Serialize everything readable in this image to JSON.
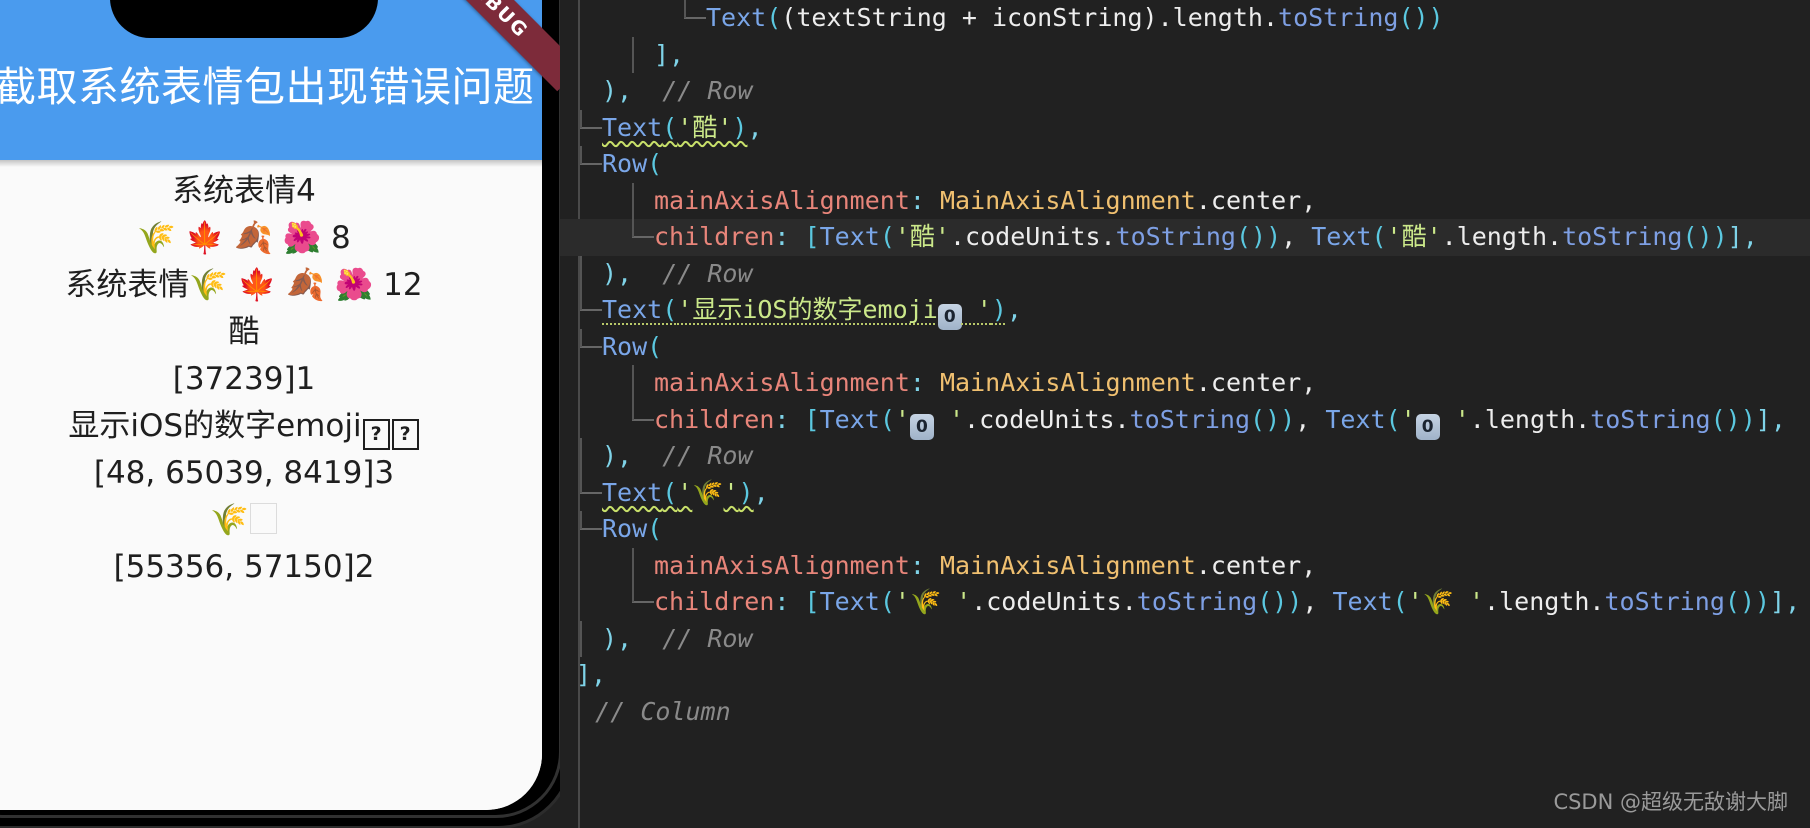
{
  "phone": {
    "appbar": {
      "title": "串截取系统表情包出现错误问题",
      "background": "#4a9bee"
    },
    "status_bar": {
      "signal_icon": "signal-dots-icon",
      "wifi_icon": "wifi-icon",
      "battery_icon": "battery-icon"
    },
    "debug_banner": "DEBUG",
    "body_lines": [
      {
        "id": "line-1",
        "text": "系统表情4"
      },
      {
        "id": "line-2",
        "text": "🌾 🍁 🍂 🌺 8"
      },
      {
        "id": "line-3",
        "text": "系统表情🌾 🍁 🍂 🌺 12"
      },
      {
        "id": "line-4",
        "text": "酷"
      },
      {
        "id": "line-5",
        "text": "[37239]1"
      },
      {
        "id": "line-6",
        "text": "显示iOS的数字emoji"
      },
      {
        "id": "line-7",
        "text": "[48, 65039, 8419]3"
      },
      {
        "id": "line-8",
        "text": "🌾"
      },
      {
        "id": "line-9",
        "text": "[55356, 57150]2"
      }
    ]
  },
  "editor": {
    "background": "#212121",
    "lines": [
      {
        "indent": 4,
        "guide": "branch",
        "parts": [
          {
            "t": "Text",
            "c": "kw"
          },
          {
            "t": "(",
            "c": "par"
          },
          {
            "t": "(textString + iconString)",
            "c": "plain"
          },
          {
            "t": ".",
            "c": "plain"
          },
          {
            "t": "length",
            "c": "plain"
          },
          {
            "t": ".",
            "c": "plain"
          },
          {
            "t": "toString",
            "c": "id-blue"
          },
          {
            "t": "())",
            "c": "par"
          }
        ]
      },
      {
        "indent": 2,
        "guide": "vline",
        "parts": [
          {
            "t": "],",
            "c": "punct"
          }
        ]
      },
      {
        "indent": 0,
        "guide": "none",
        "parts": [
          {
            "t": "),",
            "c": "punct"
          },
          {
            "t": "  // Row",
            "c": "cmt"
          }
        ]
      },
      {
        "indent": 0,
        "guide": "branch",
        "parts": [
          {
            "t": "Text",
            "c": "kw squig"
          },
          {
            "t": "(",
            "c": "par squig"
          },
          {
            "t": "'酷'",
            "c": "str squig"
          },
          {
            "t": ")",
            "c": "par squig"
          },
          {
            "t": ",",
            "c": "punct"
          }
        ]
      },
      {
        "indent": 0,
        "guide": "branch",
        "parts": [
          {
            "t": "Row",
            "c": "kw"
          },
          {
            "t": "(",
            "c": "par"
          }
        ]
      },
      {
        "indent": 2,
        "guide": "vline",
        "parts": [
          {
            "t": "mainAxisAlignment",
            "c": "param"
          },
          {
            "t": ": ",
            "c": "punct"
          },
          {
            "t": "MainAxisAlignment",
            "c": "enumv"
          },
          {
            "t": ".center",
            "c": "plain"
          },
          {
            "t": ",",
            "c": "plain"
          }
        ]
      },
      {
        "indent": 2,
        "guide": "branch",
        "hl": true,
        "parts": [
          {
            "t": "children",
            "c": "param"
          },
          {
            "t": ": ",
            "c": "punct"
          },
          {
            "t": "[",
            "c": "par"
          },
          {
            "t": "Text",
            "c": "kw"
          },
          {
            "t": "(",
            "c": "par"
          },
          {
            "t": "'酷'",
            "c": "str"
          },
          {
            "t": ".codeUnits.",
            "c": "plain"
          },
          {
            "t": "toString",
            "c": "id-blue"
          },
          {
            "t": "())",
            "c": "par"
          },
          {
            "t": ", ",
            "c": "plain"
          },
          {
            "t": "Text",
            "c": "kw"
          },
          {
            "t": "(",
            "c": "par"
          },
          {
            "t": "'酷'",
            "c": "str"
          },
          {
            "t": ".length.",
            "c": "plain"
          },
          {
            "t": "toString",
            "c": "id-blue"
          },
          {
            "t": "())",
            "c": "par"
          },
          {
            "t": "],",
            "c": "punct"
          }
        ]
      },
      {
        "indent": 0,
        "guide": "vline",
        "parts": [
          {
            "t": "),",
            "c": "punct"
          },
          {
            "t": "  // Row",
            "c": "cmt"
          }
        ]
      },
      {
        "indent": 0,
        "guide": "branch",
        "parts": [
          {
            "t": "Text",
            "c": "kw squig-dot"
          },
          {
            "t": "(",
            "c": "par squig-dot"
          },
          {
            "t": "'显示iOS的数字emoji",
            "c": "str squig-dot"
          },
          {
            "t": "0",
            "c": "keycap"
          },
          {
            "t": " '",
            "c": "str squig-dot"
          },
          {
            "t": ")",
            "c": "par squig-dot"
          },
          {
            "t": ",",
            "c": "punct"
          }
        ]
      },
      {
        "indent": 0,
        "guide": "branch",
        "parts": [
          {
            "t": "Row",
            "c": "kw"
          },
          {
            "t": "(",
            "c": "par"
          }
        ]
      },
      {
        "indent": 2,
        "guide": "vline",
        "parts": [
          {
            "t": "mainAxisAlignment",
            "c": "param"
          },
          {
            "t": ": ",
            "c": "punct"
          },
          {
            "t": "MainAxisAlignment",
            "c": "enumv"
          },
          {
            "t": ".center",
            "c": "plain"
          },
          {
            "t": ",",
            "c": "plain"
          }
        ]
      },
      {
        "indent": 2,
        "guide": "branch",
        "parts": [
          {
            "t": "children",
            "c": "param"
          },
          {
            "t": ": ",
            "c": "punct"
          },
          {
            "t": "[",
            "c": "par"
          },
          {
            "t": "Text",
            "c": "kw"
          },
          {
            "t": "(",
            "c": "par"
          },
          {
            "t": "'",
            "c": "str"
          },
          {
            "t": "0",
            "c": "keycap"
          },
          {
            "t": " '",
            "c": "str"
          },
          {
            "t": ".codeUnits.",
            "c": "plain"
          },
          {
            "t": "toString",
            "c": "id-blue"
          },
          {
            "t": "())",
            "c": "par"
          },
          {
            "t": ", ",
            "c": "plain"
          },
          {
            "t": "Text",
            "c": "kw"
          },
          {
            "t": "(",
            "c": "par"
          },
          {
            "t": "'",
            "c": "str"
          },
          {
            "t": "0",
            "c": "keycap"
          },
          {
            "t": " '",
            "c": "str"
          },
          {
            "t": ".length.",
            "c": "plain"
          },
          {
            "t": "toString",
            "c": "id-blue"
          },
          {
            "t": "())",
            "c": "par"
          },
          {
            "t": "],",
            "c": "punct"
          }
        ]
      },
      {
        "indent": 0,
        "guide": "vline",
        "parts": [
          {
            "t": "),",
            "c": "punct"
          },
          {
            "t": "  // Row",
            "c": "cmt"
          }
        ]
      },
      {
        "indent": 0,
        "guide": "branch",
        "parts": [
          {
            "t": "Text",
            "c": "kw squig"
          },
          {
            "t": "(",
            "c": "par squig"
          },
          {
            "t": "'",
            "c": "str squig"
          },
          {
            "t": "🌾",
            "c": "emo"
          },
          {
            "t": "'",
            "c": "str squig"
          },
          {
            "t": ")",
            "c": "par squig"
          },
          {
            "t": ",",
            "c": "punct"
          }
        ]
      },
      {
        "indent": 0,
        "guide": "branch",
        "parts": [
          {
            "t": "Row",
            "c": "kw"
          },
          {
            "t": "(",
            "c": "par"
          }
        ]
      },
      {
        "indent": 2,
        "guide": "vline",
        "parts": [
          {
            "t": "mainAxisAlignment",
            "c": "param"
          },
          {
            "t": ": ",
            "c": "punct"
          },
          {
            "t": "MainAxisAlignment",
            "c": "enumv"
          },
          {
            "t": ".center",
            "c": "plain"
          },
          {
            "t": ",",
            "c": "plain"
          }
        ]
      },
      {
        "indent": 2,
        "guide": "branch",
        "parts": [
          {
            "t": "children",
            "c": "param"
          },
          {
            "t": ": ",
            "c": "punct"
          },
          {
            "t": "[",
            "c": "par"
          },
          {
            "t": "Text",
            "c": "kw"
          },
          {
            "t": "(",
            "c": "par"
          },
          {
            "t": "'",
            "c": "str"
          },
          {
            "t": "🌾",
            "c": "emo"
          },
          {
            "t": " '",
            "c": "str"
          },
          {
            "t": ".codeUnits.",
            "c": "plain"
          },
          {
            "t": "toString",
            "c": "id-blue"
          },
          {
            "t": "())",
            "c": "par"
          },
          {
            "t": ", ",
            "c": "plain"
          },
          {
            "t": "Text",
            "c": "kw"
          },
          {
            "t": "(",
            "c": "par"
          },
          {
            "t": "'",
            "c": "str"
          },
          {
            "t": "🌾",
            "c": "emo"
          },
          {
            "t": " '",
            "c": "str"
          },
          {
            "t": ".length.",
            "c": "plain"
          },
          {
            "t": "toString",
            "c": "id-blue"
          },
          {
            "t": "())",
            "c": "par"
          },
          {
            "t": "],",
            "c": "punct"
          }
        ]
      },
      {
        "indent": 0,
        "guide": "vline",
        "parts": [
          {
            "t": "),",
            "c": "punct"
          },
          {
            "t": "  // Row",
            "c": "cmt"
          }
        ]
      },
      {
        "indent": -1,
        "guide": "none",
        "parts": [
          {
            "t": "],",
            "c": "punct"
          }
        ]
      },
      {
        "indent": -2,
        "guide": "none",
        "parts": [
          {
            "t": ",",
            "c": "punct"
          },
          {
            "t": "  // Column",
            "c": "cmt"
          }
        ]
      }
    ]
  },
  "watermark": "CSDN @超级无敌谢大脚"
}
